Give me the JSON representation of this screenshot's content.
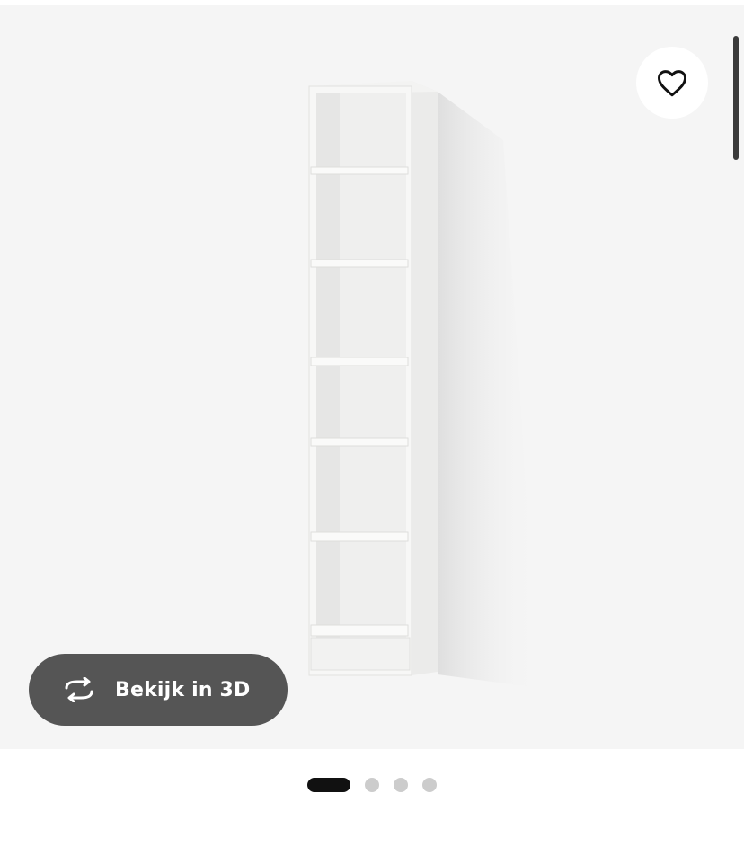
{
  "product_image": {
    "alt_icon": "bookcase-image",
    "background": "#f5f5f5"
  },
  "favorite": {
    "icon": "heart-icon"
  },
  "view_3d": {
    "icon": "rotate-3d-icon",
    "label": "Bekijk in 3D",
    "background": "#555555"
  },
  "carousel": {
    "slides": 4,
    "active_index": 0,
    "active_color": "#111111",
    "inactive_color": "#cccccc"
  }
}
